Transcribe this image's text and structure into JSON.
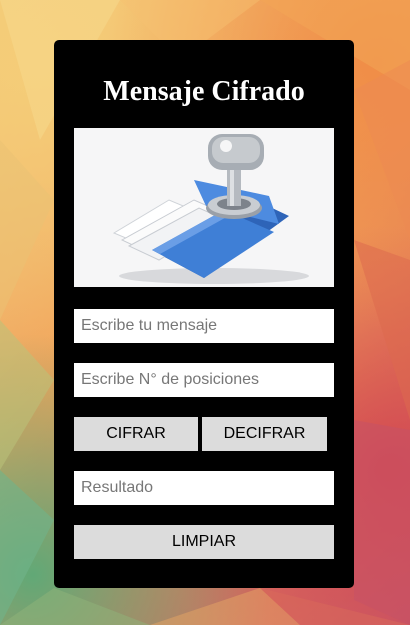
{
  "form": {
    "title": "Mensaje Cifrado",
    "image": {
      "icon": "folder-key-icon"
    },
    "message_input": {
      "placeholder": "Escribe tu mensaje",
      "value": ""
    },
    "positions_input": {
      "placeholder": "Escribe N° de posiciones",
      "value": ""
    },
    "encrypt_label": "CIFRAR",
    "decrypt_label": "DECIFRAR",
    "result_input": {
      "placeholder": "Resultado",
      "value": ""
    },
    "clear_label": "LIMPIAR"
  },
  "colors": {
    "card": "#000000",
    "button": "#dcdcdc",
    "title": "#ffffff",
    "folder": "#3f7fd6"
  }
}
